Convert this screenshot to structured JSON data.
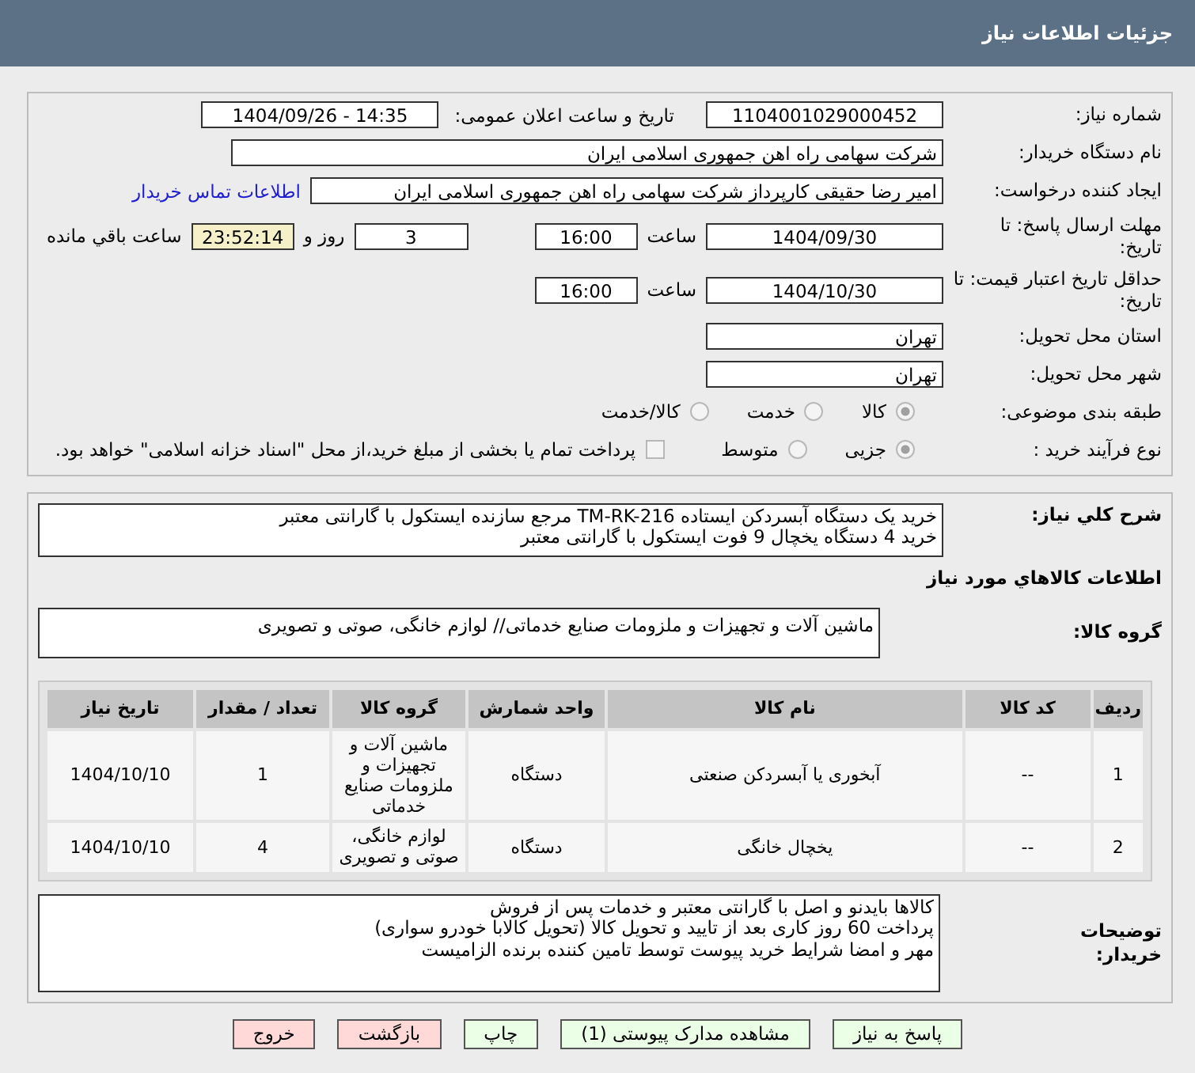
{
  "header": {
    "title": "جزئیات اطلاعات نیاز"
  },
  "need_number": {
    "label": "شماره نیاز:",
    "value": "1104001029000452"
  },
  "announce": {
    "label": "تاریخ و ساعت اعلان عمومی:",
    "value": "1404/09/26 - 14:35"
  },
  "buyer_org": {
    "label": "نام دستگاه خریدار:",
    "value": "شرکت سهامی راه اهن جمهوری اسلامی ایران"
  },
  "creator": {
    "label": "ایجاد کننده درخواست:",
    "value": "امیر رضا  حقیقی کارپرداز شرکت سهامی راه اهن جمهوری اسلامی ایران",
    "link": "اطلاعات تماس خریدار"
  },
  "deadline": {
    "label": "مهلت ارسال پاسخ: تا تاریخ:",
    "date": "1404/09/30",
    "time_label": "ساعت",
    "time": "16:00",
    "days": "3",
    "days_label": "روز و",
    "remaining": "23:52:14",
    "remaining_label": "ساعت باقي مانده"
  },
  "validity": {
    "label": "حداقل تاریخ اعتبار قیمت: تا تاریخ:",
    "date": "1404/10/30",
    "time_label": "ساعت",
    "time": "16:00"
  },
  "province": {
    "label": "استان محل تحویل:",
    "value": "تهران"
  },
  "city": {
    "label": "شهر محل تحویل:",
    "value": "تهران"
  },
  "category": {
    "label": "طبقه بندی موضوعی:",
    "options": [
      {
        "label": "کالا",
        "selected": true
      },
      {
        "label": "خدمت",
        "selected": false
      },
      {
        "label": "کالا/خدمت",
        "selected": false
      }
    ]
  },
  "process": {
    "label": "نوع فرآیند خرید :",
    "options": [
      {
        "label": "جزیی",
        "selected": true
      },
      {
        "label": "متوسط",
        "selected": false
      }
    ],
    "payment_checkbox": {
      "checked": false,
      "label": "پرداخت تمام یا بخشی از مبلغ خرید،از محل \"اسناد خزانه اسلامی\" خواهد بود."
    }
  },
  "description": {
    "label": "شرح کلي نیاز:",
    "lines": [
      "خرید یک دستگاه آبسردکن ایستاده TM-RK-216 مرجع سازنده ایستکول با گارانتی معتبر",
      "خرید 4 دستگاه یخچال 9 فوت ایستکول با گارانتی معتبر"
    ]
  },
  "goods_heading": "اطلاعات کالاهاي مورد نیاز",
  "goods_group": {
    "label": "گروه کالا:",
    "value": "ماشین آلات و تجهیزات و ملزومات صنایع خدماتی// لوازم خانگی، صوتی و تصویری"
  },
  "table": {
    "columns": [
      "ردیف",
      "کد کالا",
      "نام کالا",
      "واحد شمارش",
      "گروه کالا",
      "تعداد / مقدار",
      "تاریخ نیاز"
    ],
    "rows": [
      [
        "1",
        "--",
        "آبخوری یا آبسردکن صنعتی",
        "دستگاه",
        "ماشین آلات و تجهیزات و ملزومات صنایع خدماتی",
        "1",
        "1404/10/10"
      ],
      [
        "2",
        "--",
        "یخچال خانگی",
        "دستگاه",
        "لوازم خانگی، صوتی و تصویری",
        "4",
        "1404/10/10"
      ]
    ]
  },
  "buyer_notes": {
    "label": "توضیحات خریدار:",
    "lines": [
      "کالاها بایدنو و اصل با گارانتی معتبر و خدمات پس از فروش",
      "پرداخت 60 روز کاری بعد از تایید و تحویل کالا (تحویل کالابا خودرو سواری)",
      "مهر و امضا شرایط خرید پیوست توسط تامین کننده برنده الزامیست"
    ]
  },
  "buttons": [
    {
      "label": "پاسخ به نیاز",
      "kind": "primary"
    },
    {
      "label": "مشاهده مدارک پیوستی (1)",
      "kind": "primary"
    },
    {
      "label": "چاپ",
      "kind": "primary"
    },
    {
      "label": "بازگشت",
      "kind": "danger"
    },
    {
      "label": "خروج",
      "kind": "danger"
    }
  ]
}
